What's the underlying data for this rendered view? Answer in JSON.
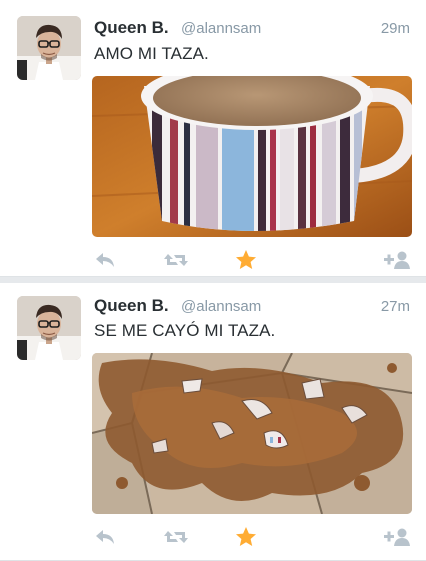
{
  "tweets": [
    {
      "name": "Queen B.",
      "handle": "@alannsam",
      "time": "29m",
      "text": "AMO MI TAZA.",
      "actions": [
        "reply-icon",
        "retweet-icon",
        "favorite-star-icon",
        "follow-icon"
      ]
    },
    {
      "name": "Queen B.",
      "handle": "@alannsam",
      "time": "27m",
      "text": "SE ME CAYÓ MI TAZA.",
      "actions": [
        "reply-icon",
        "retweet-icon",
        "favorite-star-icon",
        "follow-icon"
      ]
    }
  ],
  "colors": {
    "background": "#e6e9ec",
    "card": "#ffffff",
    "name": "#292f33",
    "meta": "#8899a6",
    "favorited_star": "#ffac33",
    "action_icon": "#b8c3cc"
  }
}
